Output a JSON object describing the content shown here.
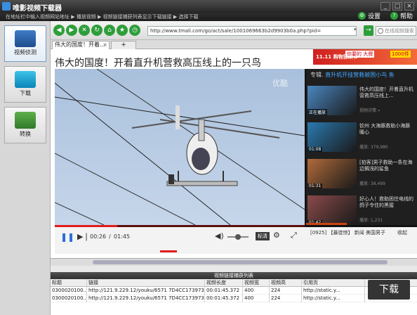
{
  "app": {
    "title": "唯影视频下载器"
  },
  "window_controls": [
    "_",
    "□",
    "×"
  ],
  "steps_text": "在地址栏中输入视频网站地址 ▶ 播放视频 ▶ 视频链接捕获列表显示下载链接 ▶ 选择下载",
  "header_buttons": {
    "settings": "设置",
    "help": "帮助"
  },
  "sidebar": {
    "items": [
      {
        "label": "视频侦测"
      },
      {
        "label": "下载"
      },
      {
        "label": "转换"
      }
    ]
  },
  "toolbar": {
    "url": "http://www.tmall.com/go/act/sale/1001069663b2d9903b0a.php?pid=",
    "search_placeholder": "在线视频搜索",
    "go_label": "→"
  },
  "tabs": {
    "active_title": "伟大的国度！开着...",
    "close": "×",
    "new_tab": "+"
  },
  "page": {
    "title": "伟大的国度！开着直升机营救高压线上的一只鸟",
    "ad_left": "11.11 购物狂欢节",
    "ad_mid": "你要的 大牌",
    "ad_right": "1000件"
  },
  "player": {
    "watermark": "优酷",
    "time_current": "00:26",
    "time_sep": "/",
    "time_total": "01:45",
    "progress": 0.25,
    "volume": 0.5,
    "quality": "标清",
    "ticker": "[0925] 【暴徒惊】 新闻  美国男子",
    "collapse": "收起",
    "special_header_prefix": "专辑.",
    "special_header_title": "直升机开挂营救被困小鸟 鱼",
    "related": [
      {
        "title": "伟大的国度！开着直升机营救高压线上...",
        "sub": "视频详情 »",
        "badge": "正在播放",
        "color": "#4a86c0"
      },
      {
        "title": "钦州 大海豚救助小海豚 暖心",
        "sub": "播放: 379,980",
        "badge": "01:08",
        "color": "#2a7ab0"
      },
      {
        "title": "[拍客]男子救助一条在海边搁浅的鲨鱼",
        "sub": "播放: 38,499",
        "badge": "01:31",
        "color": "#b06a3a"
      },
      {
        "title": "好心人！救助困住电线的鸽子令住的黑猩",
        "sub": "播放: 1,231",
        "badge": "01:42",
        "color": "#8a4a4a"
      }
    ]
  },
  "list": {
    "title": "视频链接捕获列表",
    "headers": [
      "标题",
      "链接",
      "视频长度",
      "视频宽",
      "视频高",
      "引用页"
    ],
    "rows": [
      [
        "0300020100...",
        "http://121.9.229.12/youku/6571 7D4CC1739737...",
        "00:01:45.372",
        "400",
        "224",
        "http://static.y..."
      ],
      [
        "0300020100...",
        "http://121.9.229.12/youku/6571 7D4CC1739737...",
        "00:01:45.372",
        "400",
        "224",
        "http://static.y..."
      ]
    ],
    "download_label": "下载"
  }
}
